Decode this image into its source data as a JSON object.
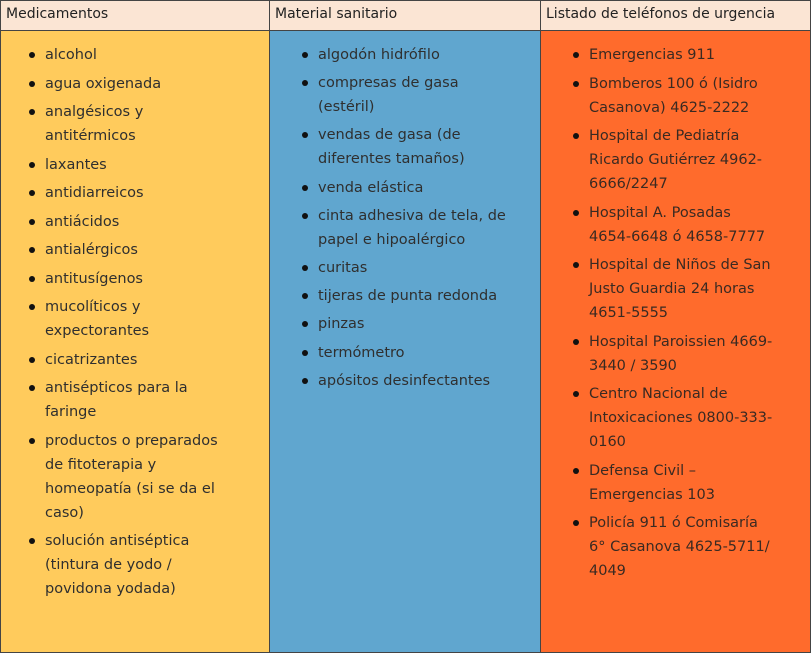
{
  "table": {
    "headers": [
      "Medicamentos",
      "Material sanitario",
      "Listado de teléfonos de urgencia"
    ],
    "medicamentos": [
      "alcohol",
      "agua oxigenada",
      "analgésicos y antitérmicos",
      "laxantes",
      "antidiarreicos",
      "antiácidos",
      "antialérgicos",
      "antitusígenos",
      "mucolíticos y expectorantes",
      "cicatrizantes",
      "antisépticos para la faringe",
      "productos o preparados de fitoterapia y homeopatía (si se da el caso)",
      "solución antiséptica (tintura de yodo / povidona yodada)"
    ],
    "material_sanitario": [
      "algodón hidrófilo",
      "compresas de gasa (estéril)",
      "vendas de gasa (de diferentes tamaños)",
      "venda elástica",
      "cinta adhesiva de tela, de papel e hipoalérgico",
      "curitas",
      "tijeras de punta redonda",
      "pinzas",
      "termómetro",
      "apósitos desinfectantes"
    ],
    "telefonos": [
      "Emergencias 911",
      "Bomberos 100 ó (Isidro Casanova) 4625-2222",
      "Hospital de Pediatría Ricardo Gutiérrez 4962-6666/2247",
      "Hospital A. Posadas 4654-6648 ó 4658-7777",
      "Hospital de Niños de San Justo Guardia 24 horas 4651-5555",
      "Hospital Paroissien 4669-3440 / 3590",
      "Centro Nacional de Intoxicaciones 0800-333-0160",
      "Defensa Civil – Emergencias 103",
      "Policía 911 ó Comisaría 6° Casanova 4625-5711/ 4049"
    ]
  },
  "colors": {
    "header_bg": "#fbe5d4",
    "col_medicamentos": "#ffcb5c",
    "col_material": "#60a6cf",
    "col_telefonos": "#ff6b2c"
  }
}
